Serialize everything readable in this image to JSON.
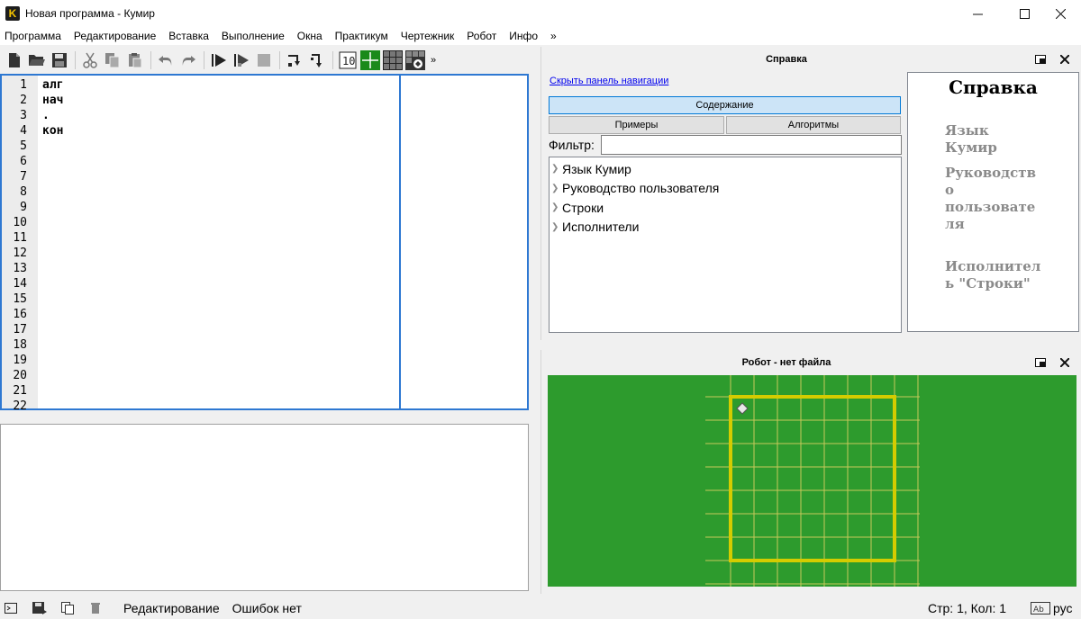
{
  "window": {
    "title": "Новая программа - Кумир",
    "app_icon_letter": "K",
    "minimize": "—",
    "maximize": "☐",
    "close": "✕"
  },
  "menu": {
    "items": [
      "Программа",
      "Редактирование",
      "Вставка",
      "Выполнение",
      "Окна",
      "Практикум",
      "Чертежник",
      "Робот",
      "Инфо"
    ],
    "overflow": "»"
  },
  "toolbar": {
    "buttons": [
      "new-file-icon",
      "open-file-icon",
      "save-icon",
      "cut-icon",
      "copy-icon",
      "paste-icon",
      "undo-icon",
      "redo-icon",
      "run-icon",
      "step-run-icon",
      "stop-icon",
      "step-over-icon",
      "step-into-icon",
      "counter-icon",
      "drawer-icon",
      "robot-grid-icon",
      "robot-edit-icon"
    ],
    "overflow": "»"
  },
  "editor": {
    "line_numbers": [
      "1",
      "2",
      "3",
      "4",
      "5",
      "6",
      "7",
      "8",
      "9",
      "10",
      "11",
      "12",
      "13",
      "14",
      "15",
      "16",
      "17",
      "18",
      "19",
      "20",
      "21",
      "22"
    ],
    "code_lines": [
      "алг",
      "нач",
      ".",
      "кон"
    ]
  },
  "statusbar": {
    "mode": "Редактирование",
    "errors": "Ошибок нет",
    "position": "Стр: 1, Кол: 1",
    "lang": "рус"
  },
  "help": {
    "panel_title": "Справка",
    "hide_nav_link": "Скрыть панель навигации",
    "tabs": {
      "contents": "Содержание",
      "examples": "Примеры",
      "algorithms": "Алгоритмы"
    },
    "filter_label": "Фильтр:",
    "filter_value": "",
    "tree_items": [
      "Язык Кумир",
      "Руководство пользователя",
      "Строки",
      "Исполнители"
    ],
    "doc": {
      "title": "Справка",
      "links": [
        "Язык Кумир",
        "Руководств о пользовате ля",
        "Исполнител ь \"Строки\""
      ]
    }
  },
  "robot": {
    "panel_title": "Робот - нет файла",
    "field_color": "#2d9b2d",
    "wall_color": "#d4cc00",
    "grid_color": "#c8c85a"
  }
}
